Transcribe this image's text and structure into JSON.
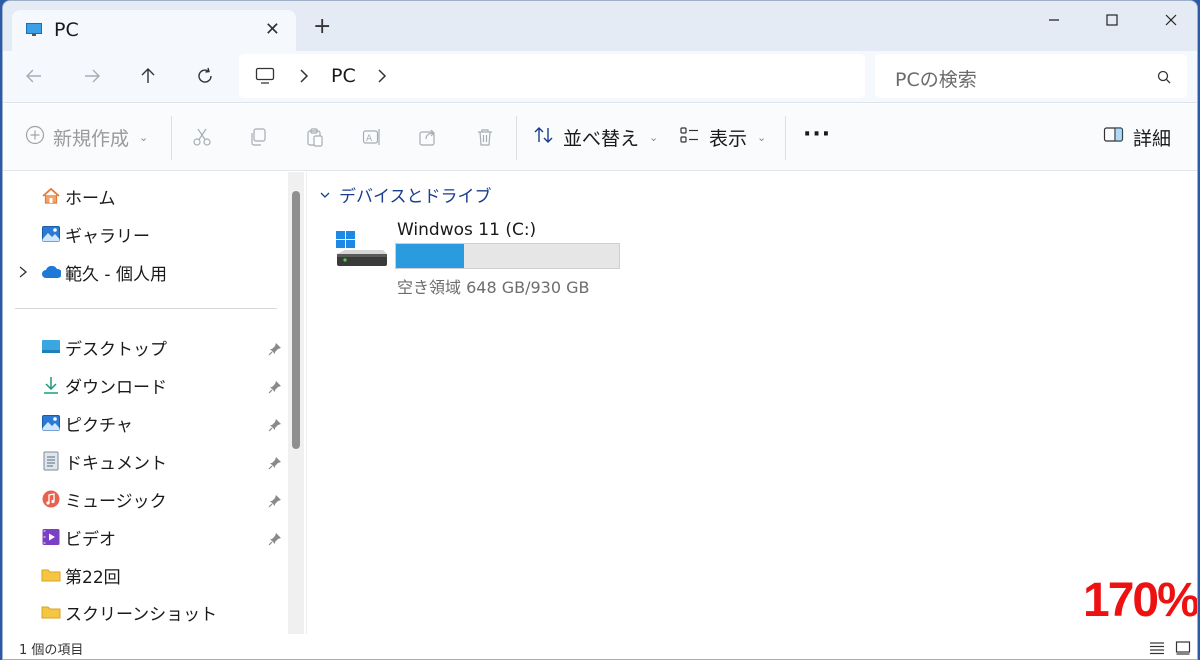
{
  "window": {
    "tab_title": "PC",
    "new_tab_symbol": "+"
  },
  "nav": {
    "address": {
      "segments": [
        "PC"
      ]
    },
    "search": {
      "placeholder": "PCの検索"
    }
  },
  "toolbar": {
    "new_label": "新規作成",
    "sort_label": "並べ替え",
    "view_label": "表示",
    "more_label": "···",
    "details_label": "詳細",
    "icons": [
      "cut-icon",
      "copy-icon",
      "paste-icon",
      "rename-icon",
      "share-icon",
      "delete-icon"
    ]
  },
  "sidebar": {
    "top_items": [
      {
        "label": "ホーム",
        "icon": "home-icon"
      },
      {
        "label": "ギャラリー",
        "icon": "gallery-icon"
      },
      {
        "label": "範久 - 個人用",
        "icon": "onedrive-cloud-icon",
        "expandable": true
      }
    ],
    "quick_access": [
      {
        "label": "デスクトップ",
        "icon": "desktop-icon",
        "pinned": true
      },
      {
        "label": "ダウンロード",
        "icon": "download-icon",
        "pinned": true
      },
      {
        "label": "ピクチャ",
        "icon": "pictures-icon",
        "pinned": true
      },
      {
        "label": "ドキュメント",
        "icon": "documents-icon",
        "pinned": true
      },
      {
        "label": "ミュージック",
        "icon": "music-icon",
        "pinned": true
      },
      {
        "label": "ビデオ",
        "icon": "videos-icon",
        "pinned": true
      },
      {
        "label": "第22回",
        "icon": "folder-icon",
        "pinned": false
      },
      {
        "label": "スクリーンショット",
        "icon": "folder-icon",
        "pinned": false
      }
    ]
  },
  "main": {
    "group_title": "デバイスとドライブ",
    "drives": [
      {
        "name": "Windwos 11 (C:)",
        "free_text": "空き領域 648 GB/930 GB",
        "used_fraction": 0.303
      }
    ]
  },
  "overlay": {
    "zoom_label": "170%"
  },
  "status": {
    "item_count": "1 個の項目"
  },
  "colors": {
    "accent": "#2b9be0",
    "group_header": "#1a3d8f",
    "zoom_label": "#ee1111"
  }
}
